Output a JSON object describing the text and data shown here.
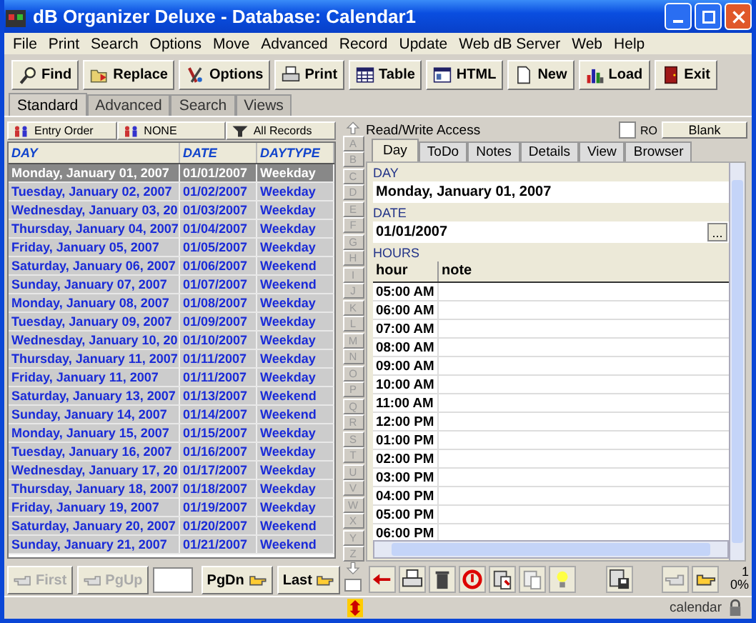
{
  "window": {
    "title": "dB Organizer Deluxe - Database: Calendar1"
  },
  "menu": [
    "File",
    "Print",
    "Search",
    "Options",
    "Move",
    "Advanced",
    "Record",
    "Update",
    "Web dB Server",
    "Web",
    "Help"
  ],
  "toolbar": [
    "Find",
    "Replace",
    "Options",
    "Print",
    "Table",
    "HTML",
    "New",
    "Load",
    "Exit"
  ],
  "view_tabs": [
    {
      "label": "Standard",
      "selected": true
    },
    {
      "label": "Advanced",
      "selected": false
    },
    {
      "label": "Search",
      "selected": false
    },
    {
      "label": "Views",
      "selected": false
    }
  ],
  "sort_buttons": [
    "Entry Order",
    "NONE",
    "All Records"
  ],
  "table": {
    "columns": [
      "DAY",
      "DATE",
      "DAYTYPE"
    ],
    "rows": [
      {
        "day": "Monday, January 01, 2007",
        "date": "01/01/2007",
        "daytype": "Weekday",
        "selected": true
      },
      {
        "day": "Tuesday, January 02, 2007",
        "date": "01/02/2007",
        "daytype": "Weekday",
        "selected": false
      },
      {
        "day": "Wednesday, January 03, 20",
        "date": "01/03/2007",
        "daytype": "Weekday",
        "selected": false
      },
      {
        "day": "Thursday, January 04, 2007",
        "date": "01/04/2007",
        "daytype": "Weekday",
        "selected": false
      },
      {
        "day": "Friday, January 05, 2007",
        "date": "01/05/2007",
        "daytype": "Weekday",
        "selected": false
      },
      {
        "day": "Saturday, January 06, 2007",
        "date": "01/06/2007",
        "daytype": "Weekend",
        "selected": false
      },
      {
        "day": "Sunday, January 07, 2007",
        "date": "01/07/2007",
        "daytype": "Weekend",
        "selected": false
      },
      {
        "day": "Monday, January 08, 2007",
        "date": "01/08/2007",
        "daytype": "Weekday",
        "selected": false
      },
      {
        "day": "Tuesday, January 09, 2007",
        "date": "01/09/2007",
        "daytype": "Weekday",
        "selected": false
      },
      {
        "day": "Wednesday, January 10, 20",
        "date": "01/10/2007",
        "daytype": "Weekday",
        "selected": false
      },
      {
        "day": "Thursday, January 11, 2007",
        "date": "01/11/2007",
        "daytype": "Weekday",
        "selected": false
      },
      {
        "day": "Friday, January 11, 2007",
        "date": "01/11/2007",
        "daytype": "Weekday",
        "selected": false
      },
      {
        "day": "Saturday, January 13, 2007",
        "date": "01/13/2007",
        "daytype": "Weekend",
        "selected": false
      },
      {
        "day": "Sunday, January 14, 2007",
        "date": "01/14/2007",
        "daytype": "Weekend",
        "selected": false
      },
      {
        "day": "Monday, January 15, 2007",
        "date": "01/15/2007",
        "daytype": "Weekday",
        "selected": false
      },
      {
        "day": "Tuesday, January 16, 2007",
        "date": "01/16/2007",
        "daytype": "Weekday",
        "selected": false
      },
      {
        "day": "Wednesday, January 17, 20",
        "date": "01/17/2007",
        "daytype": "Weekday",
        "selected": false
      },
      {
        "day": "Thursday, January 18, 2007",
        "date": "01/18/2007",
        "daytype": "Weekday",
        "selected": false
      },
      {
        "day": "Friday, January 19, 2007",
        "date": "01/19/2007",
        "daytype": "Weekday",
        "selected": false
      },
      {
        "day": "Saturday, January 20, 2007",
        "date": "01/20/2007",
        "daytype": "Weekend",
        "selected": false
      },
      {
        "day": "Sunday, January 21, 2007",
        "date": "01/21/2007",
        "daytype": "Weekend",
        "selected": false
      }
    ]
  },
  "alphabet": [
    "A",
    "B",
    "C",
    "D",
    "E",
    "F",
    "G",
    "H",
    "I",
    "J",
    "K",
    "L",
    "M",
    "N",
    "O",
    "P",
    "Q",
    "R",
    "S",
    "T",
    "U",
    "V",
    "W",
    "X",
    "Y",
    "Z"
  ],
  "strip_checkbox": {
    "checked": false
  },
  "nav_buttons": [
    {
      "label": "First",
      "disabled": true
    },
    {
      "label": "PgUp",
      "disabled": true
    },
    {
      "label": "PgDn",
      "disabled": false
    },
    {
      "label": "Last",
      "disabled": false
    }
  ],
  "access_label": "Read/Write Access",
  "ro": {
    "label": "RO",
    "checked": false
  },
  "blank_button": "Blank",
  "record_tabs": [
    {
      "label": "Day",
      "selected": true
    },
    {
      "label": "ToDo",
      "selected": false
    },
    {
      "label": "Notes",
      "selected": false
    },
    {
      "label": "Details",
      "selected": false
    },
    {
      "label": "View",
      "selected": false
    },
    {
      "label": "Browser",
      "selected": false
    }
  ],
  "fields": [
    {
      "label": "DAY",
      "value": "Monday, January 01, 2007"
    },
    {
      "label": "DATE",
      "value": "01/01/2007",
      "picker": "..."
    }
  ],
  "hours": {
    "label": "HOURS",
    "columns": [
      "hour",
      "note"
    ],
    "rows": [
      "05:00 AM",
      "06:00 AM",
      "07:00 AM",
      "08:00 AM",
      "09:00 AM",
      "10:00 AM",
      "11:00 AM",
      "12:00 PM",
      "01:00 PM",
      "02:00 PM",
      "03:00 PM",
      "04:00 PM",
      "05:00 PM",
      "06:00 PM"
    ]
  },
  "record_counter": "1",
  "percent": "0%",
  "status_bar": {
    "text": "calendar"
  }
}
